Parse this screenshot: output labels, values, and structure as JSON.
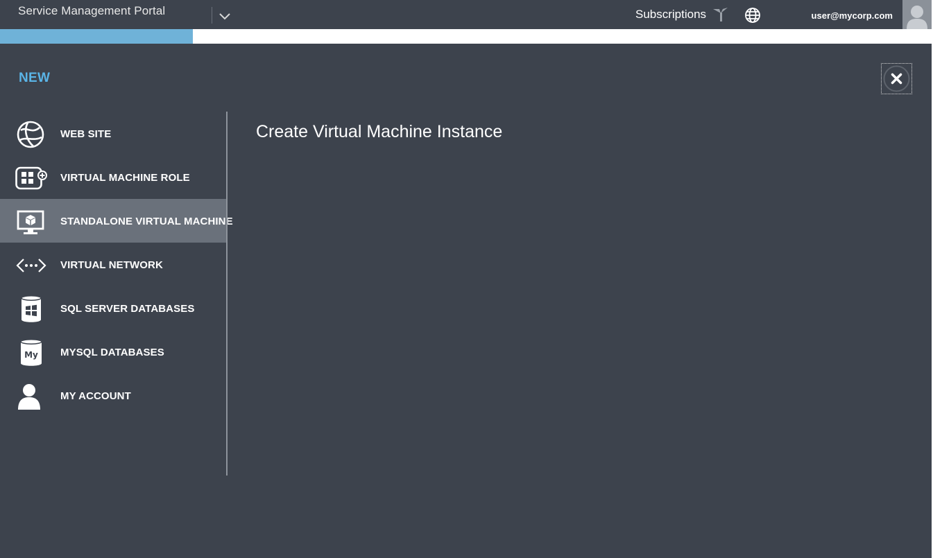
{
  "header": {
    "app_title": "Service Management Portal",
    "subscriptions_label": "Subscriptions",
    "user_email": "user@mycorp.com",
    "icons": [
      "chevron-down-icon",
      "filter-icon",
      "globe-icon",
      "user-avatar-icon"
    ]
  },
  "progress": {
    "fraction": 0.207
  },
  "panel": {
    "heading": "NEW",
    "close_icon": "close-icon",
    "content_title": "Create Virtual Machine Instance"
  },
  "menu": {
    "items": [
      {
        "label": "WEB SITE",
        "icon": "web-site-icon",
        "selected": false
      },
      {
        "label": "VIRTUAL MACHINE ROLE",
        "icon": "vm-role-icon",
        "selected": false
      },
      {
        "label": "STANDALONE VIRTUAL MACHINE",
        "icon": "standalone-vm-icon",
        "selected": true
      },
      {
        "label": "VIRTUAL NETWORK",
        "icon": "virtual-network-icon",
        "selected": false
      },
      {
        "label": "SQL SERVER DATABASES",
        "icon": "sql-database-icon",
        "selected": false
      },
      {
        "label": "MYSQL DATABASES",
        "icon": "mysql-database-icon",
        "selected": false
      },
      {
        "label": "MY ACCOUNT",
        "icon": "account-icon",
        "selected": false
      }
    ]
  },
  "colors": {
    "background": "#3d434d",
    "accent": "#5ab4e6",
    "progress": "#6fb2d8",
    "selected_item": "#6a717b"
  }
}
